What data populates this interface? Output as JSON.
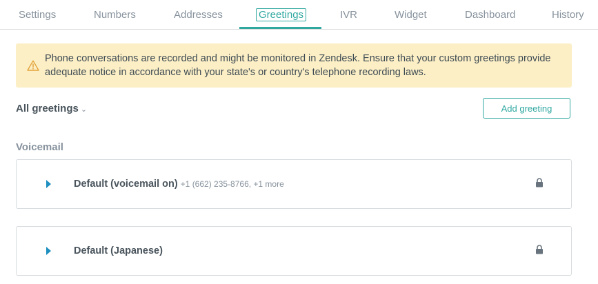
{
  "tabs": [
    {
      "label": "Settings"
    },
    {
      "label": "Numbers"
    },
    {
      "label": "Addresses"
    },
    {
      "label": "Greetings"
    },
    {
      "label": "IVR"
    },
    {
      "label": "Widget"
    },
    {
      "label": "Dashboard"
    },
    {
      "label": "History"
    }
  ],
  "active_tab": "Greetings",
  "notice": {
    "icon": "warning-icon",
    "text": "Phone conversations are recorded and might be monitored in Zendesk. Ensure that your custom greetings provide adequate notice in accordance with your state's or country's telephone recording laws."
  },
  "filter": {
    "label": "All greetings",
    "icon": "chevron-down-icon"
  },
  "add_button": {
    "label": "Add greeting"
  },
  "sections": [
    {
      "title": "Voicemail",
      "greetings": [
        {
          "name": "Default (voicemail on)",
          "detail": "+1 (662) 235-8766, +1 more",
          "locked": true
        },
        {
          "name": "Default (Japanese)",
          "detail": "",
          "locked": true
        }
      ]
    }
  ],
  "colors": {
    "accent": "#30a8a0",
    "notice_bg": "#fcefc6",
    "warning": "#e3a43b",
    "expand_arrow": "#1f8fbf"
  }
}
